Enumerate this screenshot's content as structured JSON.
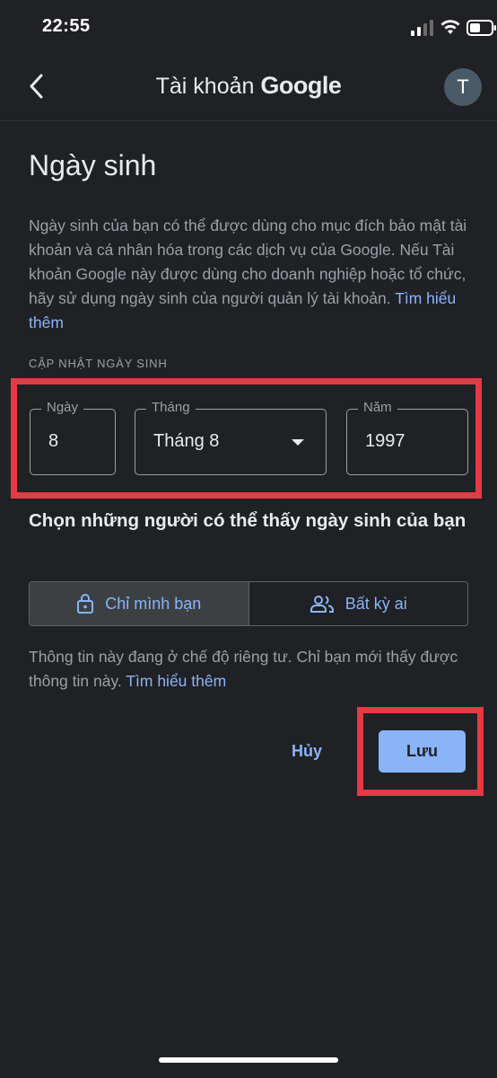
{
  "status_bar": {
    "time": "22:55"
  },
  "app_bar": {
    "title_prefix": "Tài khoản",
    "title_brand": "Google",
    "avatar_initial": "T"
  },
  "page": {
    "title": "Ngày sinh",
    "description": "Ngày sinh của bạn có thể được dùng cho mục đích bảo mật tài khoản và cá nhân hóa trong các dịch vụ của Google. Nếu Tài khoản Google này được dùng cho doanh nghiệp hoặc tổ chức, hãy sử dụng ngày sinh của người quản lý tài khoản.",
    "learn_more": "Tìm hiểu thêm"
  },
  "birthday_form": {
    "section_label": "CẬP NHẬT NGÀY SINH",
    "day": {
      "label": "Ngày",
      "value": "8"
    },
    "month": {
      "label": "Tháng",
      "value": "Tháng 8"
    },
    "year": {
      "label": "Năm",
      "value": "1997"
    }
  },
  "visibility": {
    "title": "Chọn những người có thể thấy ngày sinh của bạn",
    "options": [
      {
        "label": "Chỉ mình bạn",
        "icon": "lock-icon",
        "selected": true
      },
      {
        "label": "Bất kỳ ai",
        "icon": "people-icon",
        "selected": false
      }
    ],
    "note": "Thông tin này đang ở chế độ riêng tư. Chỉ bạn mới thấy được thông tin này.",
    "learn_more": "Tìm hiểu thêm"
  },
  "actions": {
    "cancel_label": "Hủy",
    "save_label": "Lưu"
  },
  "colors": {
    "background": "#202124",
    "accent": "#8ab4f8",
    "annotation": "#e53946"
  }
}
